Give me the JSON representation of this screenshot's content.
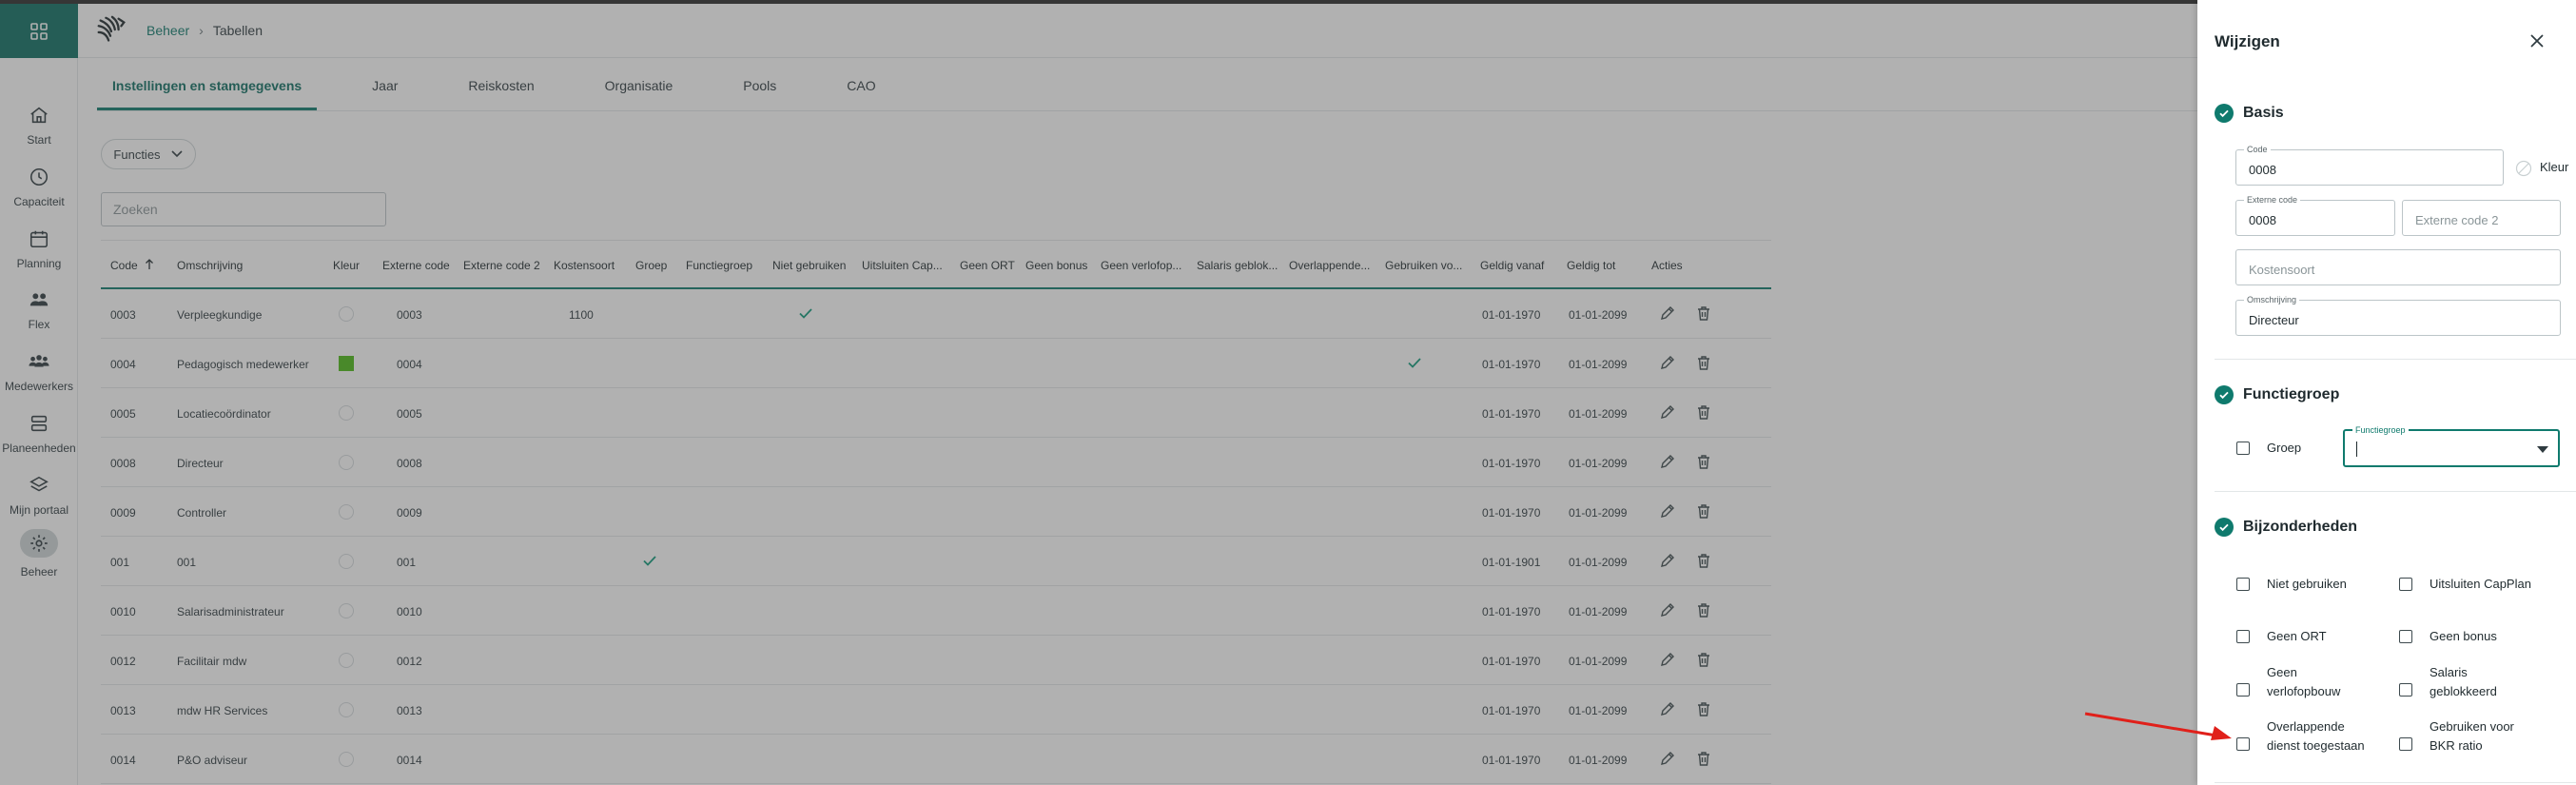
{
  "breadcrumb": {
    "root": "Beheer",
    "current": "Tabellen"
  },
  "nav": {
    "items": [
      {
        "label": "Start",
        "icon": "home-icon"
      },
      {
        "label": "Capaciteit",
        "icon": "clock-icon"
      },
      {
        "label": "Planning",
        "icon": "calendar-icon"
      },
      {
        "label": "Flex",
        "icon": "users-icon"
      },
      {
        "label": "Medewerkers",
        "icon": "team-icon"
      },
      {
        "label": "Planeenheden",
        "icon": "units-icon"
      },
      {
        "label": "Mijn portaal",
        "icon": "layers-icon"
      },
      {
        "label": "Beheer",
        "icon": "gear-icon"
      }
    ]
  },
  "tabs": [
    "Instellingen en stamgegevens",
    "Jaar",
    "Reiskosten",
    "Organisatie",
    "Pools",
    "CAO"
  ],
  "filter": {
    "dropdown_label": "Functies",
    "search_placeholder": "Zoeken"
  },
  "table": {
    "columns": [
      "Code",
      "Omschrijving",
      "Kleur",
      "Externe code",
      "Externe code 2",
      "Kostensoort",
      "Groep",
      "Functiegroep",
      "Niet gebruiken",
      "Uitsluiten Cap...",
      "Geen ORT",
      "Geen bonus",
      "Geen verlofop...",
      "Salaris geblok...",
      "Overlappende...",
      "Gebruiken vo...",
      "Geldig vanaf",
      "Geldig tot",
      "Acties"
    ],
    "rows": [
      {
        "code": "0003",
        "omschrijving": "Verpleegkundige",
        "kleur": "none",
        "extern": "0003",
        "kostensoort": "1100",
        "groep": false,
        "niet_gebruiken": true,
        "bkr": false,
        "vanaf": "01-01-1970",
        "tot": "01-01-2099"
      },
      {
        "code": "0004",
        "omschrijving": "Pedagogisch medewerker",
        "kleur": "#4cbb17",
        "extern": "0004",
        "kostensoort": "",
        "groep": false,
        "niet_gebruiken": false,
        "bkr": true,
        "vanaf": "01-01-1970",
        "tot": "01-01-2099"
      },
      {
        "code": "0005",
        "omschrijving": "Locatiecoördinator",
        "kleur": "none",
        "extern": "0005",
        "kostensoort": "",
        "groep": false,
        "niet_gebruiken": false,
        "bkr": false,
        "vanaf": "01-01-1970",
        "tot": "01-01-2099"
      },
      {
        "code": "0008",
        "omschrijving": "Directeur",
        "kleur": "none",
        "extern": "0008",
        "kostensoort": "",
        "groep": false,
        "niet_gebruiken": false,
        "bkr": false,
        "vanaf": "01-01-1970",
        "tot": "01-01-2099"
      },
      {
        "code": "0009",
        "omschrijving": "Controller",
        "kleur": "none",
        "extern": "0009",
        "kostensoort": "",
        "groep": false,
        "niet_gebruiken": false,
        "bkr": false,
        "vanaf": "01-01-1970",
        "tot": "01-01-2099"
      },
      {
        "code": "001",
        "omschrijving": "001",
        "kleur": "none",
        "extern": "001",
        "kostensoort": "",
        "groep": true,
        "niet_gebruiken": false,
        "bkr": false,
        "vanaf": "01-01-1901",
        "tot": "01-01-2099"
      },
      {
        "code": "0010",
        "omschrijving": "Salarisadministrateur",
        "kleur": "none",
        "extern": "0010",
        "kostensoort": "",
        "groep": false,
        "niet_gebruiken": false,
        "bkr": false,
        "vanaf": "01-01-1970",
        "tot": "01-01-2099"
      },
      {
        "code": "0012",
        "omschrijving": "Facilitair mdw",
        "kleur": "none",
        "extern": "0012",
        "kostensoort": "",
        "groep": false,
        "niet_gebruiken": false,
        "bkr": false,
        "vanaf": "01-01-1970",
        "tot": "01-01-2099"
      },
      {
        "code": "0013",
        "omschrijving": "mdw HR Services",
        "kleur": "none",
        "extern": "0013",
        "kostensoort": "",
        "groep": false,
        "niet_gebruiken": false,
        "bkr": false,
        "vanaf": "01-01-1970",
        "tot": "01-01-2099"
      },
      {
        "code": "0014",
        "omschrijving": "P&O adviseur",
        "kleur": "none",
        "extern": "0014",
        "kostensoort": "",
        "groep": false,
        "niet_gebruiken": false,
        "bkr": false,
        "vanaf": "01-01-1970",
        "tot": "01-01-2099"
      }
    ]
  },
  "panel": {
    "title": "Wijzigen",
    "basis": {
      "title": "Basis",
      "code_label": "Code",
      "code_value": "0008",
      "kleur_label": "Kleur",
      "extern_label": "Externe code",
      "extern_value": "0008",
      "extern2_placeholder": "Externe code 2",
      "kostensoort_placeholder": "Kostensoort",
      "omschrijving_label": "Omschrijving",
      "omschrijving_value": "Directeur"
    },
    "functiegroep": {
      "title": "Functiegroep",
      "groep_label": "Groep",
      "select_label": "Functiegroep"
    },
    "bijzonderheden": {
      "title": "Bijzonderheden",
      "options": [
        [
          "Niet gebruiken"
        ],
        [
          "Uitsluiten CapPlan"
        ],
        [
          "Geen ORT"
        ],
        [
          "Geen bonus"
        ],
        [
          "Geen",
          "verlofopbouw"
        ],
        [
          "Salaris",
          "geblokkeerd"
        ],
        [
          "Overlappende",
          "dienst toegestaan"
        ],
        [
          "Gebruiken voor",
          "BKR ratio"
        ]
      ]
    }
  },
  "colors": {
    "brand": "#0f6e63",
    "accent": "#0f7a6d",
    "annotation_arrow": "#e0201a"
  }
}
